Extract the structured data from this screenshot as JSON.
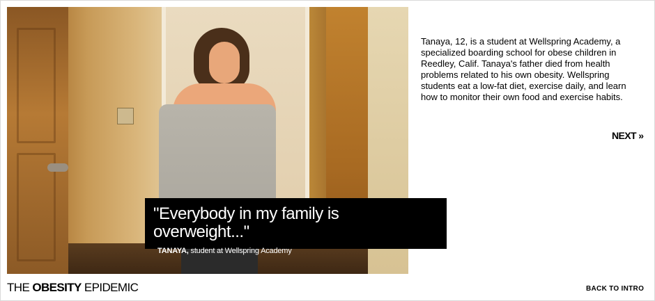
{
  "photo": {
    "alt": "Tanaya standing in a doorway"
  },
  "quote": {
    "text": "\"Everybody in my family is overweight...\"",
    "name": "TANAYA,",
    "role": "student at Wellspring Academy"
  },
  "caption": {
    "text": "Tanaya, 12, is a student at Wellspring Academy, a specialized boarding school for obese children in Reedley, Calif. Tanaya's father died from health problems related to his own obesity. Wellspring students eat a low-fat diet, exercise daily, and learn how to monitor their own food and exercise habits."
  },
  "nav": {
    "next_label": "NEXT »",
    "back_label": "BACK TO INTRO"
  },
  "brand": {
    "prefix": "THE",
    "bold": "OBESITY",
    "suffix": "EPIDEMIC"
  }
}
